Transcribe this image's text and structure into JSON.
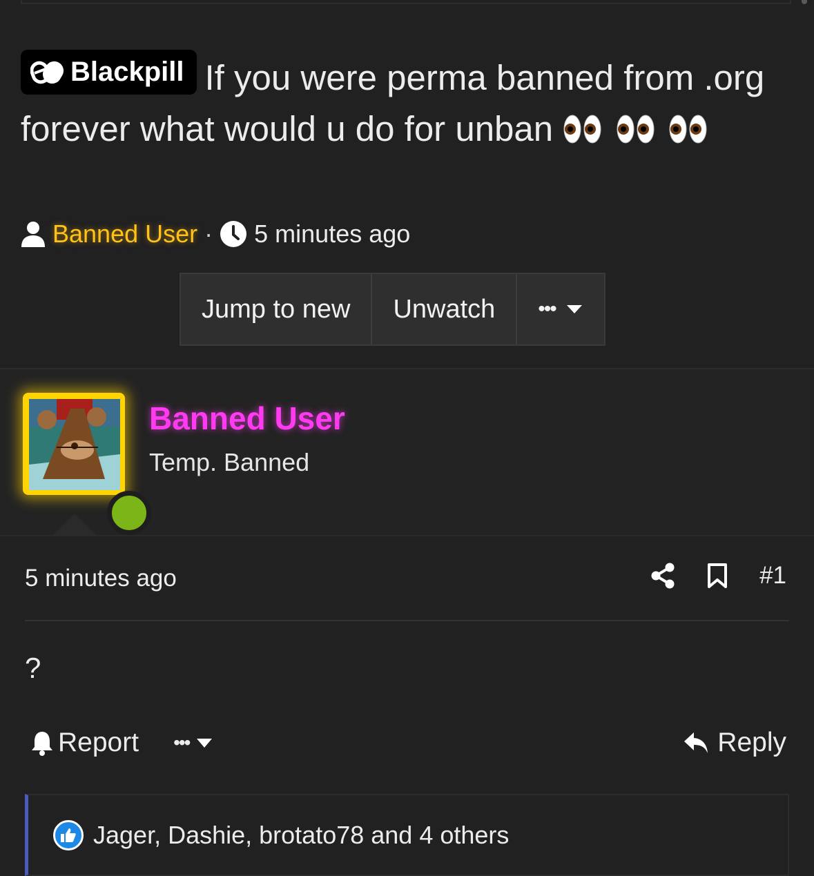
{
  "thread": {
    "prefix": "Blackpill",
    "title": "If you were perma banned from .org forever what would u do for unban",
    "emoji_name": "eyes-emoji",
    "author": "Banned User",
    "separator": "·",
    "time": "5 minutes ago"
  },
  "thread_buttons": {
    "jump": "Jump to new",
    "unwatch": "Unwatch",
    "more": "•••"
  },
  "user": {
    "name": "Banned User",
    "title": "Temp. Banned",
    "online": true
  },
  "post": {
    "time": "5 minutes ago",
    "number": "#1",
    "body": "?",
    "report": "Report",
    "more": "•••",
    "reply": "Reply"
  },
  "reactions": {
    "text": "Jager, Dashie, brotato78 and 4 others"
  },
  "colors": {
    "background": "#212121",
    "author_highlight": "#ffc21a",
    "user_name": "#ff3bf1",
    "online": "#7cb518",
    "reaction_bar": "#4a5bbd"
  }
}
